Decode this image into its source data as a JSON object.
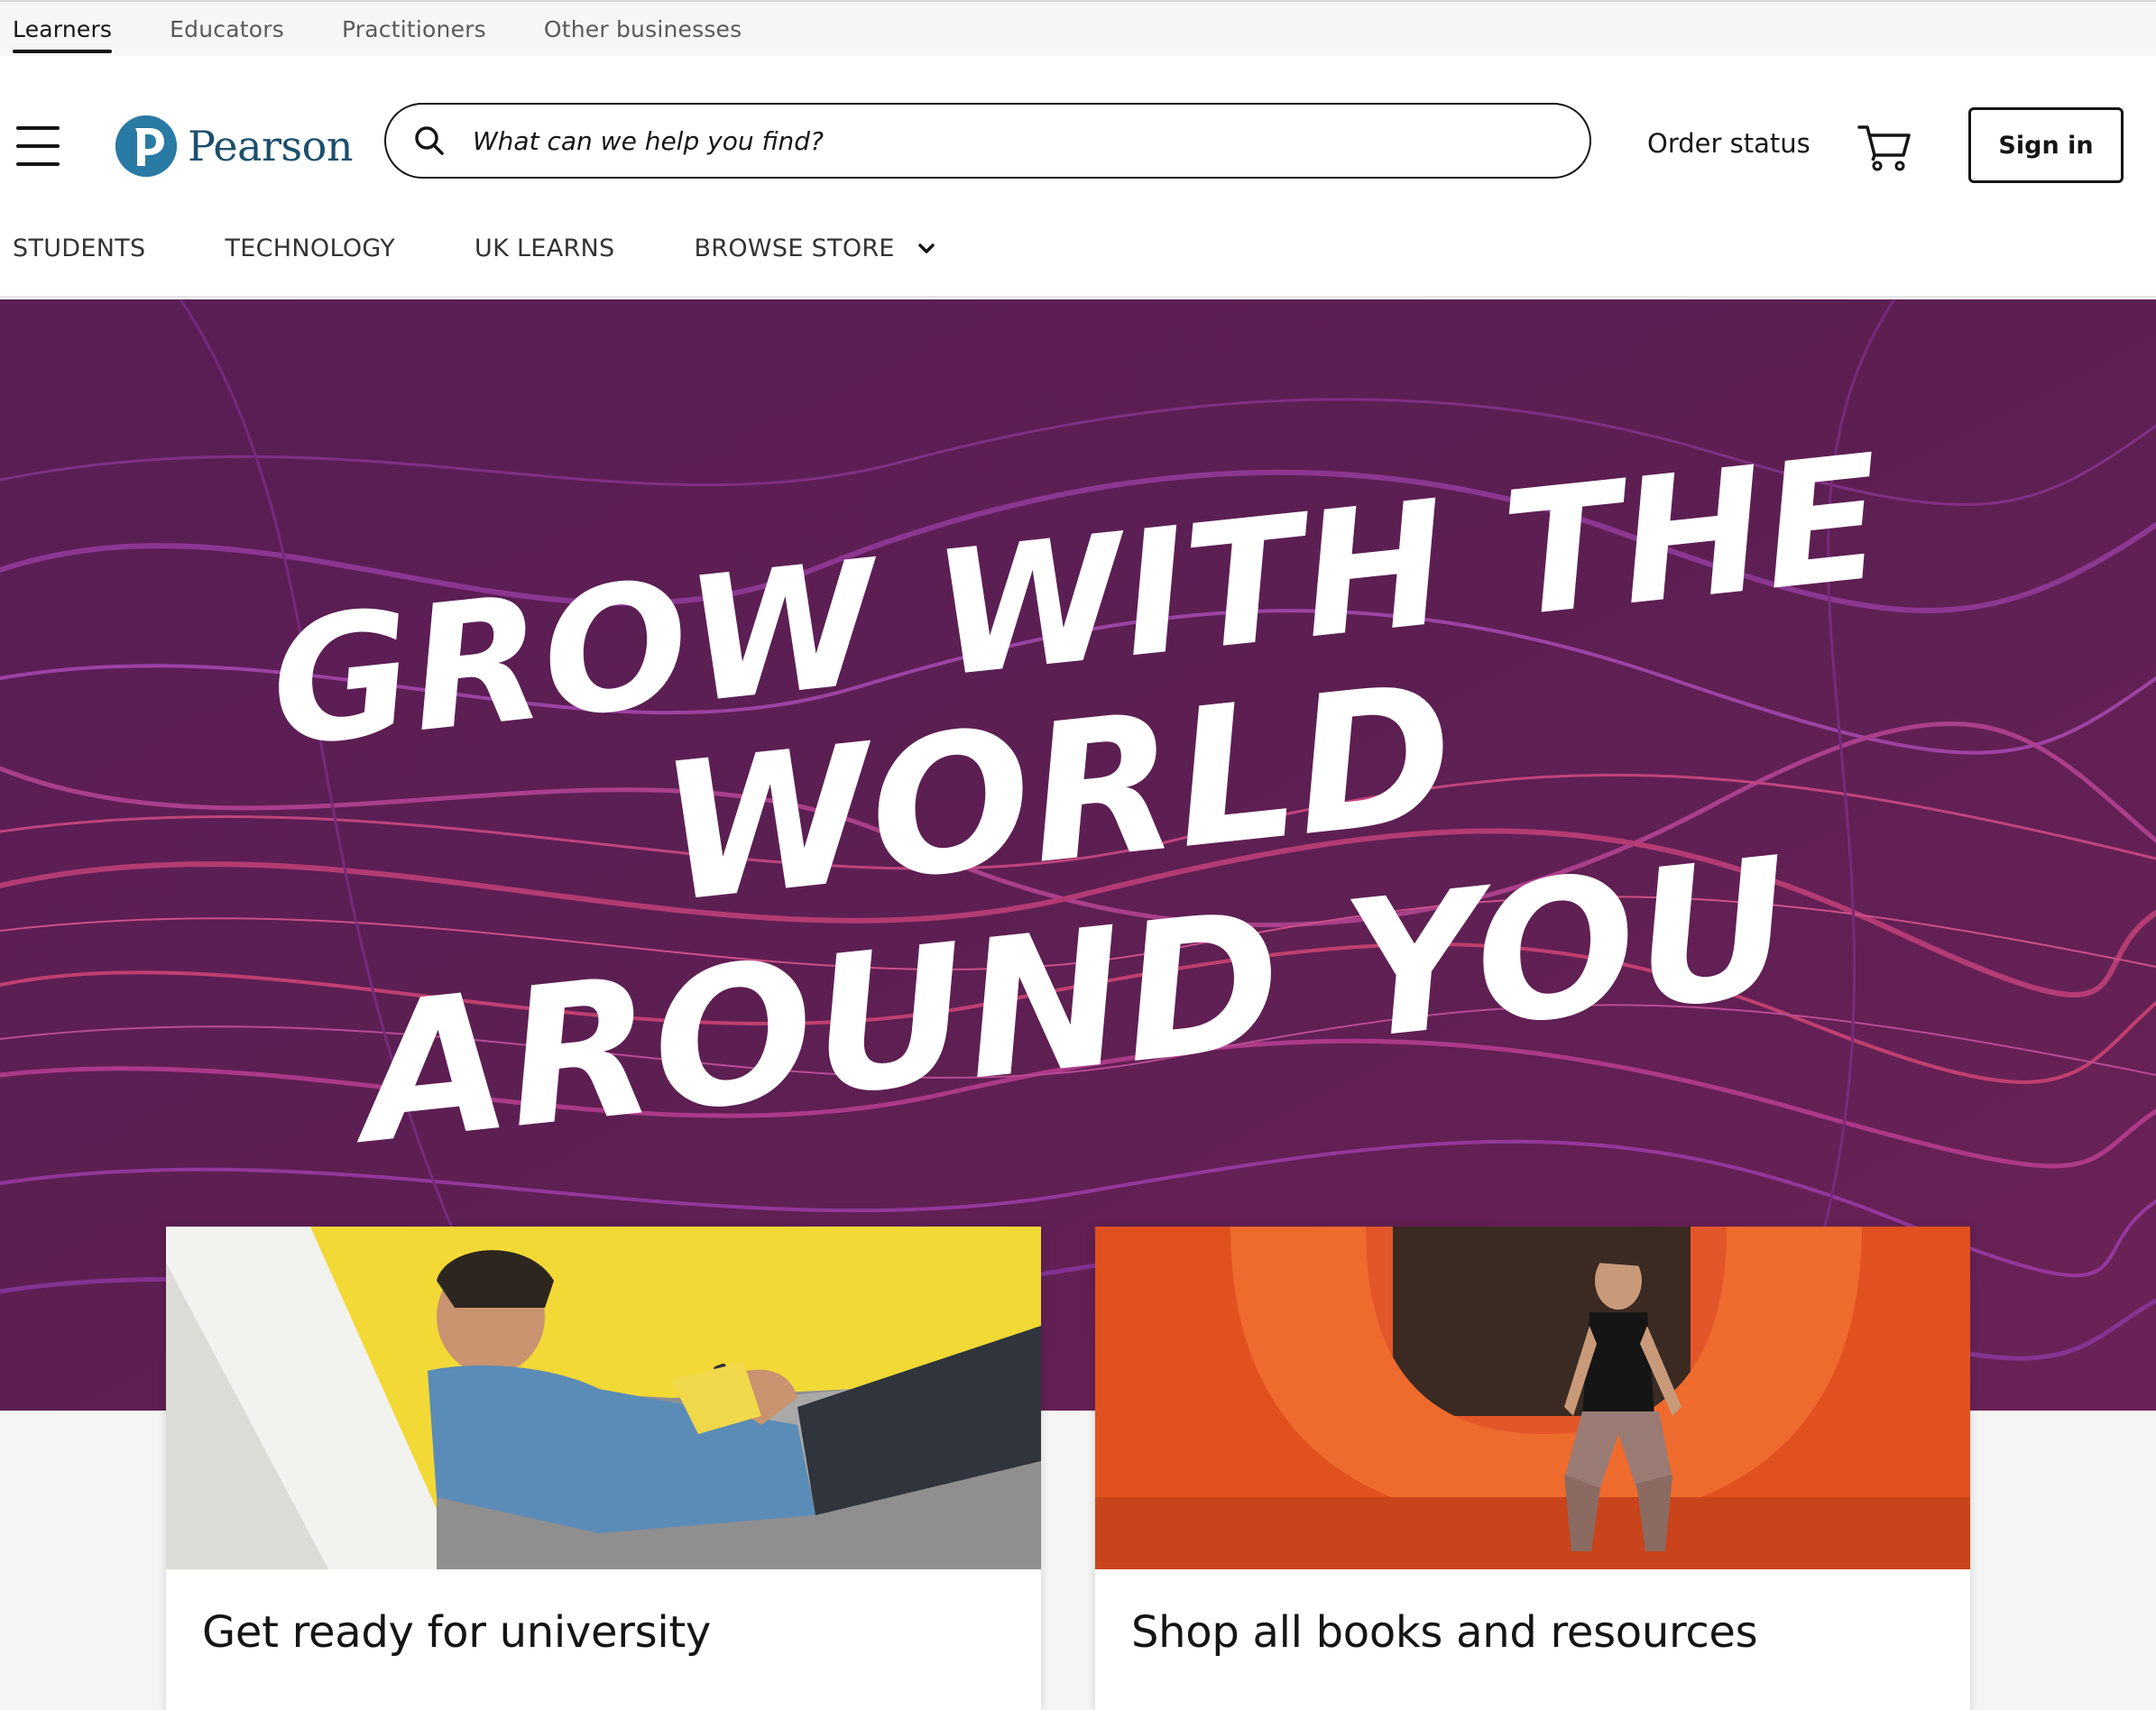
{
  "audience_tabs": [
    {
      "label": "Learners",
      "active": true
    },
    {
      "label": "Educators",
      "active": false
    },
    {
      "label": "Practitioners",
      "active": false
    },
    {
      "label": "Other businesses",
      "active": false
    }
  ],
  "header": {
    "logo_text": "Pearson",
    "search_placeholder": "What can we help you find?",
    "order_status": "Order status",
    "sign_in": "Sign in"
  },
  "nav": [
    {
      "label": "STUDENTS"
    },
    {
      "label": "TECHNOLOGY"
    },
    {
      "label": "UK LEARNS"
    },
    {
      "label": "BROWSE STORE",
      "has_dropdown": true
    }
  ],
  "hero": {
    "line1": "GROW WITH THE",
    "line2": "WORLD",
    "line3": "AROUND YOU"
  },
  "cards": [
    {
      "title": "Get ready for university"
    },
    {
      "title": "Shop all books and resources"
    }
  ],
  "colors": {
    "hero_bg": "#5b1f52",
    "brand_blue": "#1f6f9a",
    "text": "#151515"
  }
}
